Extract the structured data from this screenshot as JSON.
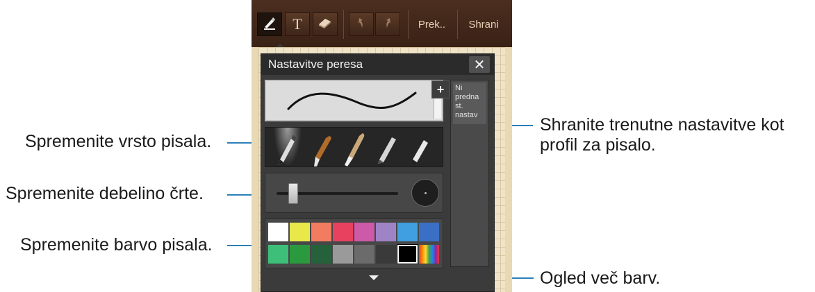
{
  "toolbar": {
    "tools": [
      {
        "name": "pen",
        "icon": "pen-icon"
      },
      {
        "name": "text",
        "icon": "text-icon",
        "glyph": "T"
      },
      {
        "name": "eraser",
        "icon": "eraser-icon"
      }
    ],
    "undo_icon": "undo-icon",
    "redo_icon": "redo-icon",
    "cancel_label": "Prek..",
    "save_label": "Shrani"
  },
  "panel": {
    "title": "Nastavitve peresa",
    "close_glyph": "✕",
    "add_glyph": "+",
    "preset_text": "Ni predna st. nastav",
    "pen_types": [
      "fountain-pen",
      "brush",
      "chinese-brush",
      "pencil",
      "marker"
    ],
    "thickness_level": 0.13,
    "colors_row1": [
      "#ffffff",
      "#e8e84a",
      "#f27c5f",
      "#e8405f",
      "#cc5aa8",
      "#9e84c4",
      "#3f9fe0",
      "#3b6fc6"
    ],
    "colors_row2": [
      "#3dbf7a",
      "#2b9a3e",
      "#25613a",
      "#9a9a9a",
      "#6b6b6b",
      "#3a3a3a",
      "#000000",
      "rainbow"
    ],
    "selected_color": "#000000"
  },
  "callouts": {
    "pen_type": "Spremenite vrsto pisala.",
    "thickness": "Spremenite debelino črte.",
    "color": "Spremenite barvo pisala.",
    "save_profile_1": "Shranite trenutne nastavitve kot",
    "save_profile_2": "profil za pisalo.",
    "more_colors": "Ogled več barv."
  }
}
